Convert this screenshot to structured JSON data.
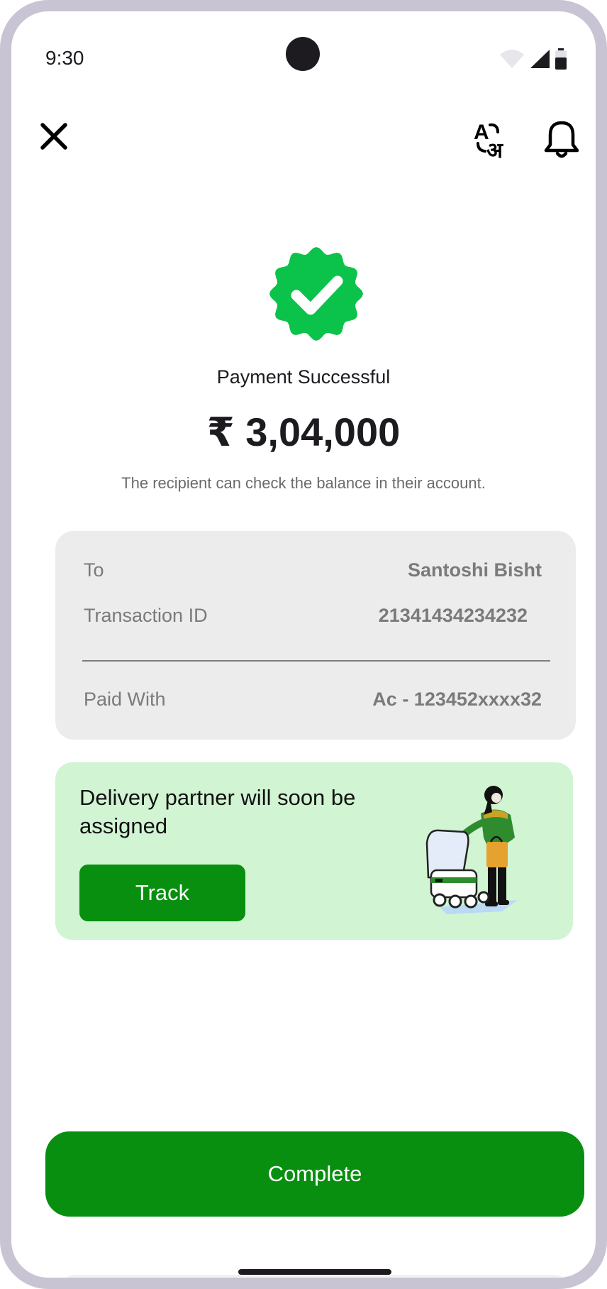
{
  "status_bar": {
    "time": "9:30",
    "icons": [
      "wifi-icon",
      "signal-icon",
      "battery-icon"
    ]
  },
  "top_bar": {
    "close_icon": "close-icon",
    "translate_icon": "translate-icon",
    "translate_glyph_latin": "A",
    "translate_glyph_devanagari": "अ",
    "bell_icon": "bell-icon"
  },
  "payment": {
    "badge_icon": "check-badge-icon",
    "status": "Payment Successful",
    "amount": "₹ 3,04,000",
    "subtitle": "The recipient can check the balance in their account."
  },
  "details": {
    "to_label": "To",
    "to_value": "Santoshi Bisht",
    "txn_label": "Transaction ID",
    "txn_value": "21341434234232",
    "paid_label": "Paid With",
    "paid_value": "Ac - 123452xxxx32"
  },
  "delivery": {
    "message": "Delivery partner will soon be assigned",
    "track_label": "Track",
    "illustration_icon": "delivery-robot-illustration"
  },
  "footer": {
    "complete_label": "Complete"
  },
  "colors": {
    "primary_green": "#088f0f",
    "badge_green": "#0bc24a",
    "delivery_bg": "#d1f4d2",
    "card_bg": "#ececec",
    "frame": "#c9c4d3"
  }
}
